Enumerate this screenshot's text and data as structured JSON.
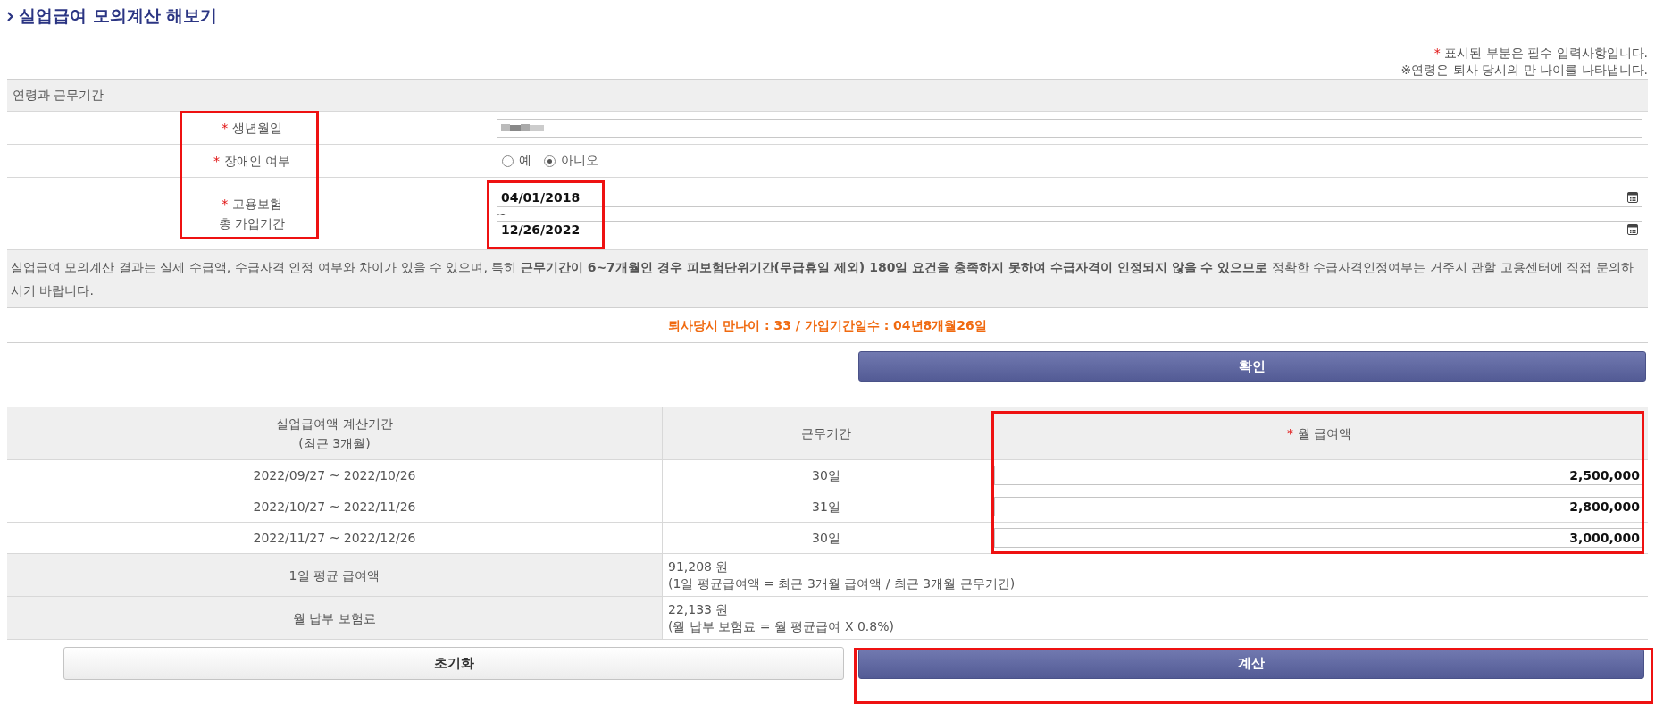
{
  "page_title": "실업급여 모의계산 해보기",
  "notes": {
    "required_mark": "*",
    "required_text": "표시된 부분은 필수 입력사항입니다.",
    "age_note": "※연령은 퇴사 당시의 만 나이를 나타냅니다."
  },
  "section": {
    "title": "연령과 근무기간",
    "labels_highlighted": true
  },
  "birth_date": {
    "label": "생년월일",
    "required": true,
    "redacted": true
  },
  "disability": {
    "label": "장애인 여부",
    "required": true,
    "options": [
      {
        "label": "예",
        "selected": false
      },
      {
        "label": "아니오",
        "selected": true
      }
    ]
  },
  "insurance_period": {
    "label_lines": [
      "고용보험",
      "총 가입기간"
    ],
    "required": true,
    "from": "04/01/2018",
    "separator": "~",
    "to": "12/26/2022",
    "highlighted": true
  },
  "notice": "실업급여 모의계산 결과는 실제 수급액, 수급자격 인정 여부와 차이가 있을 수 있으며, 특히 **근무기간이 6~7개월인 경우 피보험단위기간(무급휴일 제외) 180일 요건을 충족하지 못하여 수급자격이 인정되지 않을 수 있으므로** 정확한 수급자격인정여부는 거주지 관할 고용센터에 직접 문의하시기 바랍니다.",
  "result": "퇴사당시 만나이 : 33 / 가입기간일수 : 04년8개월26일",
  "confirm_button": "확인",
  "salary_table": {
    "columns": [
      {
        "lines": [
          "실업급여액 계산기간",
          "(최근 3개월)"
        ],
        "required": false
      },
      {
        "lines": [
          "근무기간"
        ],
        "required": false
      },
      {
        "lines": [
          "월 급여액"
        ],
        "required": true
      }
    ],
    "highlighted": true,
    "rows": [
      {
        "period": "2022/09/27 ~ 2022/10/26",
        "days": "30일",
        "salary": "2,500,000"
      },
      {
        "period": "2022/10/27 ~ 2022/11/26",
        "days": "31일",
        "salary": "2,800,000"
      },
      {
        "period": "2022/11/27 ~ 2022/12/26",
        "days": "30일",
        "salary": "3,000,000"
      }
    ],
    "summary": [
      {
        "label": "1일 평균 급여액",
        "value": "91,208 원",
        "formula": "(1일 평균급여액 = 최근 3개월 급여액 / 최근 3개월 근무기간)"
      },
      {
        "label": "월 납부 보험료",
        "value": "22,133 원",
        "formula": "(월 납부 보험료 = 월 평균급여 X 0.8%)"
      }
    ]
  },
  "buttons": [
    {
      "label": "초기화",
      "kind": "reset",
      "highlighted": false
    },
    {
      "label": "계산",
      "kind": "primary",
      "highlighted": true
    }
  ]
}
